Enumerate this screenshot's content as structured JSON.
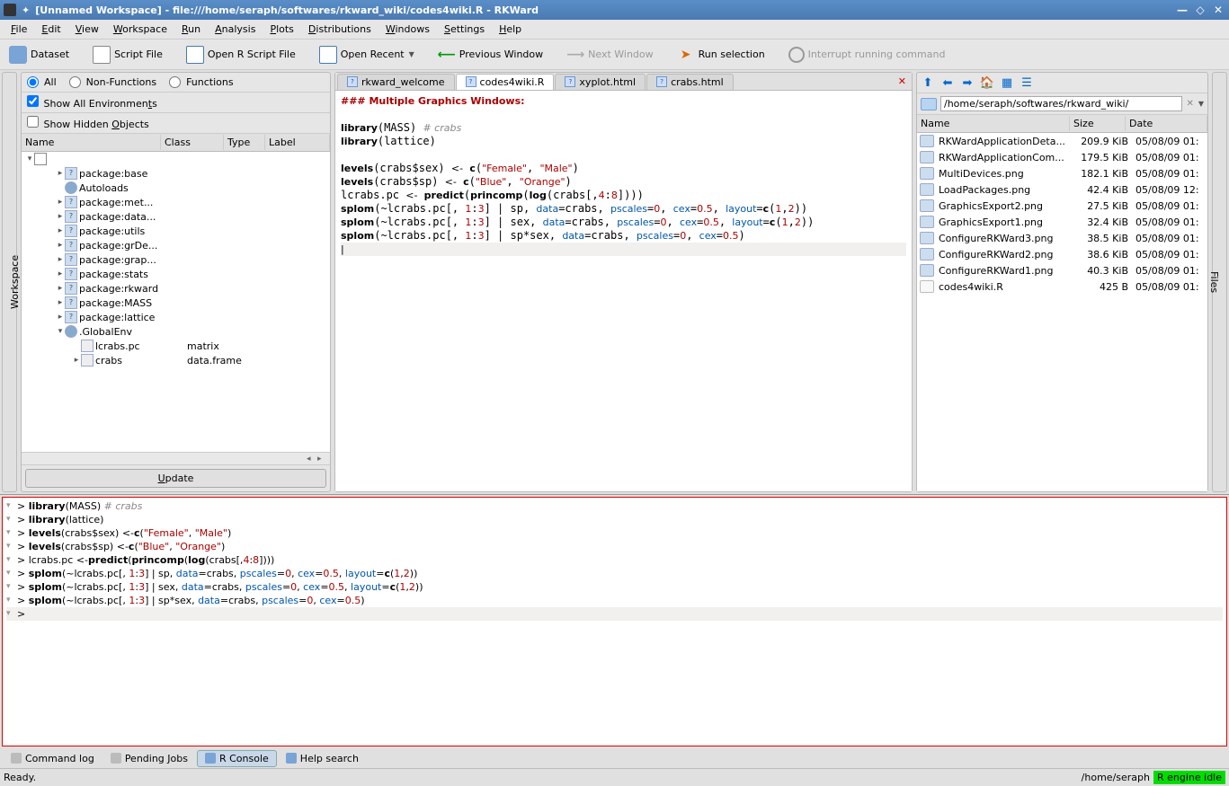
{
  "window": {
    "title": "[Unnamed Workspace] - file:///home/seraph/softwares/rkward_wiki/codes4wiki.R - RKWard"
  },
  "menubar": [
    "File",
    "Edit",
    "View",
    "Workspace",
    "Run",
    "Analysis",
    "Plots",
    "Distributions",
    "Windows",
    "Settings",
    "Help"
  ],
  "toolbar": {
    "dataset": "Dataset",
    "script": "Script File",
    "open": "Open R Script File",
    "recent": "Open Recent",
    "prev": "Previous Window",
    "next": "Next Window",
    "run": "Run selection",
    "interrupt": "Interrupt running command"
  },
  "sidebar_left": {
    "label": "Workspace"
  },
  "sidebar_right": {
    "label": "Files"
  },
  "workspace": {
    "filters": {
      "all": "All",
      "nonfunc": "Non-Functions",
      "func": "Functions"
    },
    "show_all_env": "Show All Environments",
    "show_hidden": "Show Hidden Objects",
    "columns": {
      "name": "Name",
      "class": "Class",
      "type": "Type",
      "label": "Label"
    },
    "tree": [
      {
        "depth": 1,
        "exp": "▸",
        "icon": "?",
        "name": "package:base"
      },
      {
        "depth": 1,
        "exp": "",
        "icon": "globe",
        "name": "Autoloads"
      },
      {
        "depth": 1,
        "exp": "▸",
        "icon": "?",
        "name": "package:met..."
      },
      {
        "depth": 1,
        "exp": "▸",
        "icon": "?",
        "name": "package:data..."
      },
      {
        "depth": 1,
        "exp": "▸",
        "icon": "?",
        "name": "package:utils"
      },
      {
        "depth": 1,
        "exp": "▸",
        "icon": "?",
        "name": "package:grDe..."
      },
      {
        "depth": 1,
        "exp": "▸",
        "icon": "?",
        "name": "package:grap..."
      },
      {
        "depth": 1,
        "exp": "▸",
        "icon": "?",
        "name": "package:stats"
      },
      {
        "depth": 1,
        "exp": "▸",
        "icon": "?",
        "name": "package:rkward"
      },
      {
        "depth": 1,
        "exp": "▸",
        "icon": "?",
        "name": "package:MASS"
      },
      {
        "depth": 1,
        "exp": "▸",
        "icon": "?",
        "name": "package:lattice"
      },
      {
        "depth": 1,
        "exp": "▾",
        "icon": "globe",
        "name": ".GlobalEnv"
      },
      {
        "depth": 2,
        "exp": "",
        "icon": "data",
        "name": "lcrabs.pc",
        "class": "matrix"
      },
      {
        "depth": 2,
        "exp": "▸",
        "icon": "data",
        "name": "crabs",
        "class": "data.frame"
      }
    ],
    "update": "Update"
  },
  "editor": {
    "tabs": [
      {
        "label": "rkward_welcome",
        "icon": "?"
      },
      {
        "label": "codes4wiki.R",
        "icon": "?",
        "active": true
      },
      {
        "label": "xyplot.html",
        "icon": "?"
      },
      {
        "label": "crabs.html",
        "icon": "?"
      }
    ]
  },
  "filebrowser": {
    "path": "/home/seraph/softwares/rkward_wiki/",
    "columns": {
      "name": "Name",
      "size": "Size",
      "date": "Date"
    },
    "files": [
      {
        "name": "RKWardApplicationDeta...",
        "size": "209.9 KiB",
        "date": "05/08/09 01:",
        "icon": "img"
      },
      {
        "name": "RKWardApplicationCom...",
        "size": "179.5 KiB",
        "date": "05/08/09 01:",
        "icon": "img"
      },
      {
        "name": "MultiDevices.png",
        "size": "182.1 KiB",
        "date": "05/08/09 01:",
        "icon": "img"
      },
      {
        "name": "LoadPackages.png",
        "size": "42.4 KiB",
        "date": "05/08/09 12:",
        "icon": "img"
      },
      {
        "name": "GraphicsExport2.png",
        "size": "27.5 KiB",
        "date": "05/08/09 01:",
        "icon": "img"
      },
      {
        "name": "GraphicsExport1.png",
        "size": "32.4 KiB",
        "date": "05/08/09 01:",
        "icon": "img"
      },
      {
        "name": "ConfigureRKWard3.png",
        "size": "38.5 KiB",
        "date": "05/08/09 01:",
        "icon": "img"
      },
      {
        "name": "ConfigureRKWard2.png",
        "size": "38.6 KiB",
        "date": "05/08/09 01:",
        "icon": "img"
      },
      {
        "name": "ConfigureRKWard1.png",
        "size": "40.3 KiB",
        "date": "05/08/09 01:",
        "icon": "img"
      },
      {
        "name": "codes4wiki.R",
        "size": "425 B",
        "date": "05/08/09 01:",
        "icon": "r"
      }
    ]
  },
  "bottom_tabs": [
    {
      "label": "Command log",
      "icon": "plain"
    },
    {
      "label": "Pending Jobs",
      "icon": "plain"
    },
    {
      "label": "R Console",
      "icon": "blue",
      "active": true
    },
    {
      "label": "Help search",
      "icon": "blue"
    }
  ],
  "statusbar": {
    "ready": "Ready.",
    "path": "/home/seraph",
    "engine": "R engine idle"
  }
}
